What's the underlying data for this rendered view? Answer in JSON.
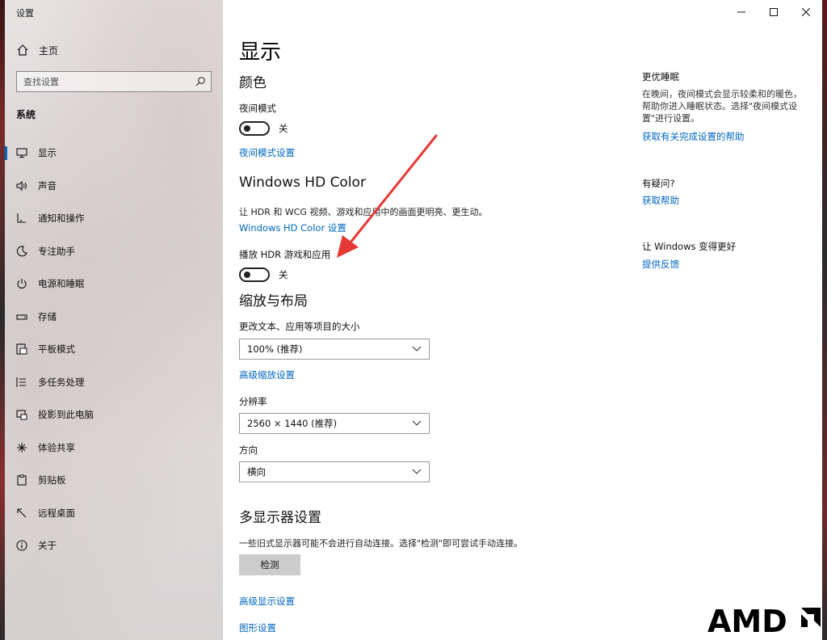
{
  "app": {
    "title": "设置"
  },
  "sidebar": {
    "home_label": "主页",
    "search_placeholder": "查找设置",
    "section_title": "系统",
    "items": [
      {
        "label": "显示",
        "icon": "monitor-icon",
        "active": true
      },
      {
        "label": "声音",
        "icon": "speaker-icon"
      },
      {
        "label": "通知和操作",
        "icon": "notification-icon"
      },
      {
        "label": "专注助手",
        "icon": "moon-icon"
      },
      {
        "label": "电源和睡眠",
        "icon": "power-icon"
      },
      {
        "label": "存储",
        "icon": "storage-icon"
      },
      {
        "label": "平板模式",
        "icon": "tablet-icon"
      },
      {
        "label": "多任务处理",
        "icon": "multitask-icon"
      },
      {
        "label": "投影到此电脑",
        "icon": "projection-icon"
      },
      {
        "label": "体验共享",
        "icon": "share-icon"
      },
      {
        "label": "剪贴板",
        "icon": "clipboard-icon"
      },
      {
        "label": "远程桌面",
        "icon": "remote-icon"
      },
      {
        "label": "关于",
        "icon": "info-icon"
      }
    ]
  },
  "main": {
    "page_title": "显示",
    "color": {
      "heading": "颜色",
      "night_mode_label": "夜间模式",
      "night_mode_state": "关",
      "night_mode_settings_link": "夜间模式设置"
    },
    "hdr": {
      "heading": "Windows HD Color",
      "description": "让 HDR 和 WCG 视频、游戏和应用中的画面更明亮、更生动。",
      "settings_link": "Windows HD Color 设置",
      "play_label": "播放 HDR 游戏和应用",
      "play_state": "关"
    },
    "scale": {
      "heading": "缩放与布局",
      "size_label": "更改文本、应用等项目的大小",
      "size_value": "100% (推荐)",
      "advanced_link": "高级缩放设置",
      "resolution_label": "分辨率",
      "resolution_value": "2560 × 1440 (推荐)",
      "orientation_label": "方向",
      "orientation_value": "横向"
    },
    "multi": {
      "heading": "多显示器设置",
      "description": "一些旧式显示器可能不会进行自动连接。选择\"检测\"即可尝试手动连接。",
      "detect_button": "检测",
      "advanced_display_link": "高级显示设置",
      "graphics_link": "图形设置"
    }
  },
  "side_panel": {
    "sleep_title": "更优睡眠",
    "sleep_desc": "在晚间，夜间模式会显示较柔和的暖色，帮助你进入睡眠状态。选择\"夜间模式设置\"进行设置。",
    "sleep_link": "获取有关完成设置的帮助",
    "question_title": "有疑问?",
    "help_link": "获取帮助",
    "improve_title": "让 Windows 变得更好",
    "feedback_link": "提供反馈"
  },
  "watermark": "AMD",
  "colors": {
    "accent": "#0067c0",
    "arrow": "#e53935"
  }
}
